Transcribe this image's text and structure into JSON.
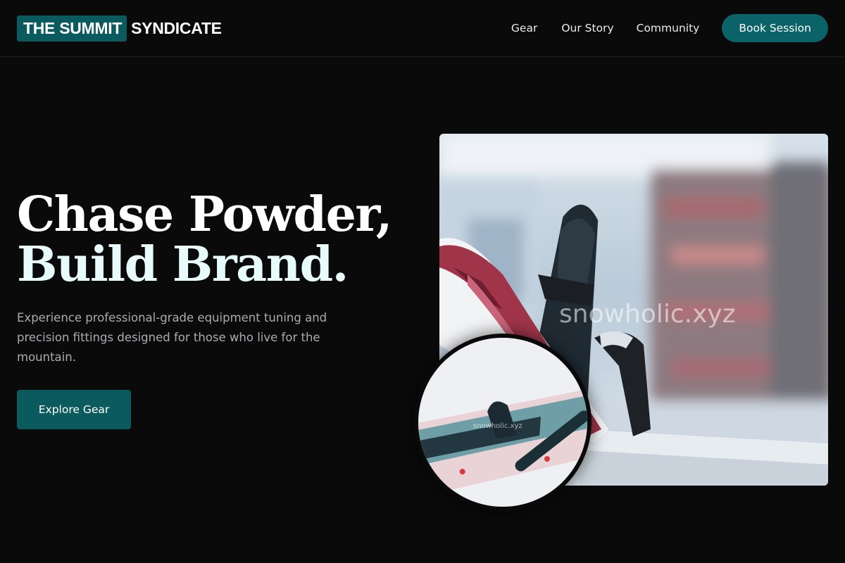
{
  "header": {
    "logo_part1": "THE SUMMIT",
    "logo_part2": "SYNDICATE",
    "nav": [
      "Gear",
      "Our Story",
      "Community"
    ],
    "cta_label": "Book Session"
  },
  "hero": {
    "title_line1": "Chase Powder,",
    "title_line2": "Build Brand.",
    "description": "Experience professional-grade equipment tuning and precision fittings designed for those who live for the mountain.",
    "cta_label": "Explore Gear"
  },
  "images": {
    "main_watermark": "snowholic.xyz",
    "inset_watermark": "snowholic.xyz"
  },
  "colors": {
    "background": "#0a0a0b",
    "accent": "#0b5a5e",
    "text": "#ffffff",
    "muted": "#a9acb0"
  }
}
